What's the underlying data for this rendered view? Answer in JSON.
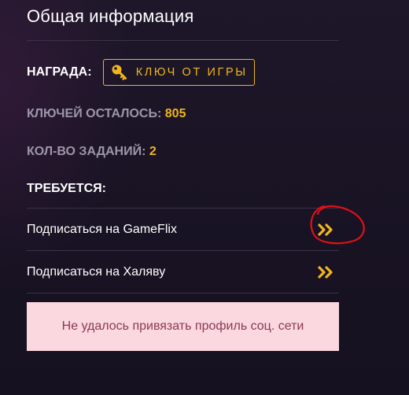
{
  "section": {
    "title": "Общая информация"
  },
  "reward": {
    "label": "НАГРАДА:",
    "badge_text": "КЛЮЧ ОТ ИГРЫ",
    "badge_icon": "key-icon"
  },
  "stats": {
    "keys_left_label": "КЛЮЧЕЙ ОСТАЛОСЬ:",
    "keys_left_value": "805",
    "tasks_count_label": "КОЛ-ВО ЗАДАНИЙ:",
    "tasks_count_value": "2"
  },
  "requirements": {
    "heading": "ТРЕБУЕТСЯ:",
    "items": [
      {
        "label": "Подписаться на GameFlix",
        "icon": "double-chevron-right-icon"
      },
      {
        "label": "Подписаться на Халяву",
        "icon": "double-chevron-right-icon"
      }
    ]
  },
  "alert": {
    "message": "Не удалось привязать профиль соц. сети"
  },
  "colors": {
    "accent": "#f2b51c",
    "muted_label": "#9c97a8",
    "background": "#1b1527",
    "divider": "#3a3346",
    "alert_bg": "#fbd7df",
    "alert_text": "#8a3b4d",
    "annotation": "#e0101a"
  }
}
